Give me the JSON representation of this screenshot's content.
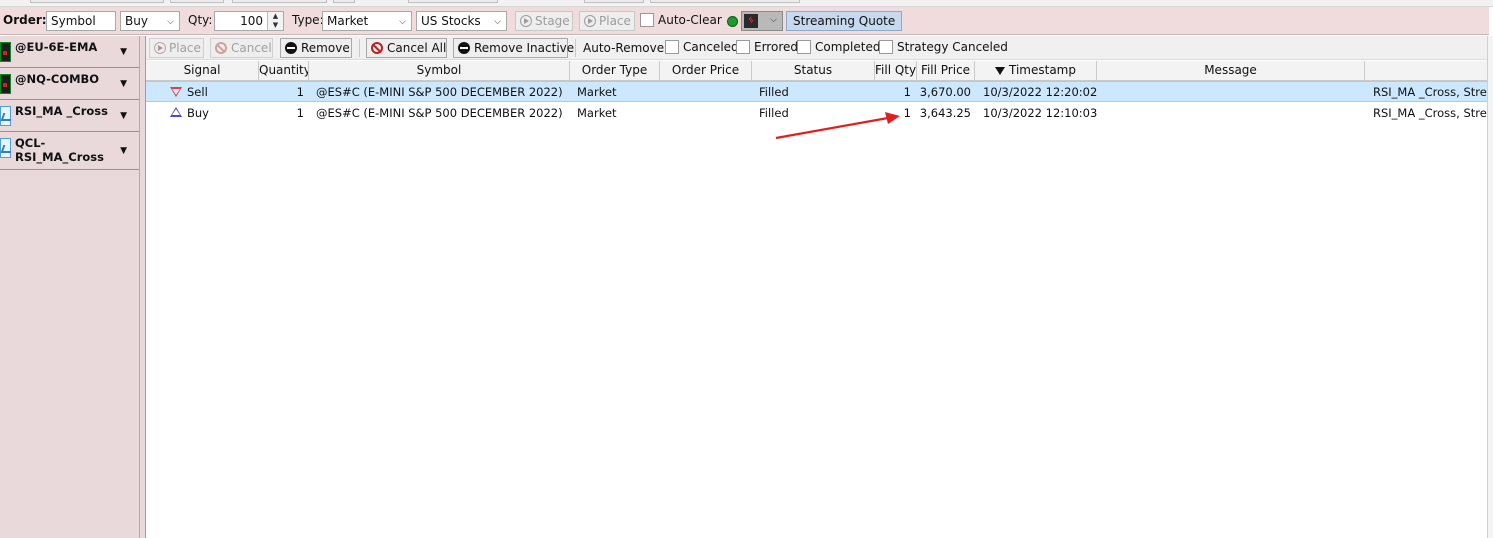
{
  "order_bar": {
    "order_label": "Order:",
    "symbol_value": "Symbol",
    "side_value": "Buy",
    "qty_label": "Qty:",
    "qty_value": "100",
    "type_label": "Type:",
    "type_value": "Market",
    "market_value": "US Stocks",
    "stage_label": "Stage",
    "place_label": "Place",
    "auto_clear_label": "Auto-Clear",
    "streaming_quote_label": "Streaming Quote"
  },
  "sidebar": {
    "items": [
      {
        "label": "@EU-6E-EMA",
        "icon": "chart-dark-icon"
      },
      {
        "label": "@NQ-COMBO",
        "icon": "chart-dark-icon"
      },
      {
        "label": "RSI_MA _Cross",
        "icon": "strategy-chart-icon"
      },
      {
        "label": "QCL-\nRSI_MA_Cross",
        "icon": "strategy-chart-icon"
      }
    ]
  },
  "toolbar": {
    "place_label": "Place",
    "cancel_label": "Cancel",
    "remove_label": "Remove",
    "cancel_all_label": "Cancel All",
    "remove_inactive_label": "Remove Inactive",
    "auto_remove_label": "Auto-Remove:",
    "canceled_label": "Canceled",
    "errored_label": "Errored",
    "completed_label": "Completed",
    "strategy_canceled_label": "Strategy Canceled"
  },
  "table": {
    "headers": {
      "signal": "Signal",
      "quantity": "Quantity",
      "symbol": "Symbol",
      "order_type": "Order Type",
      "order_price": "Order Price",
      "status": "Status",
      "fill_qty": "Fill Qty",
      "fill_price": "Fill Price",
      "timestamp": "Timestamp",
      "message": "Message"
    },
    "rows": [
      {
        "signal": "Sell",
        "quantity": "1",
        "symbol": "@ES#C (E-MINI S&P 500 DECEMBER 2022)",
        "order_type": "Market",
        "order_price": "",
        "status": "Filled",
        "fill_qty": "1",
        "fill_price": "3,670.00",
        "timestamp": "10/3/2022 12:20:02",
        "message": "",
        "strategy": "RSI_MA _Cross, Strean"
      },
      {
        "signal": "Buy",
        "quantity": "1",
        "symbol": "@ES#C (E-MINI S&P 500 DECEMBER 2022)",
        "order_type": "Market",
        "order_price": "",
        "status": "Filled",
        "fill_qty": "1",
        "fill_price": "3,643.25",
        "timestamp": "10/3/2022 12:10:03",
        "message": "",
        "strategy": "RSI_MA _Cross, Strean"
      }
    ]
  },
  "colors": {
    "order_bar_bg": "#f0dcdc",
    "sidebar_bg": "#ead9db",
    "selected_row": "#cce8ff",
    "annotation_arrow": "#e02020"
  }
}
